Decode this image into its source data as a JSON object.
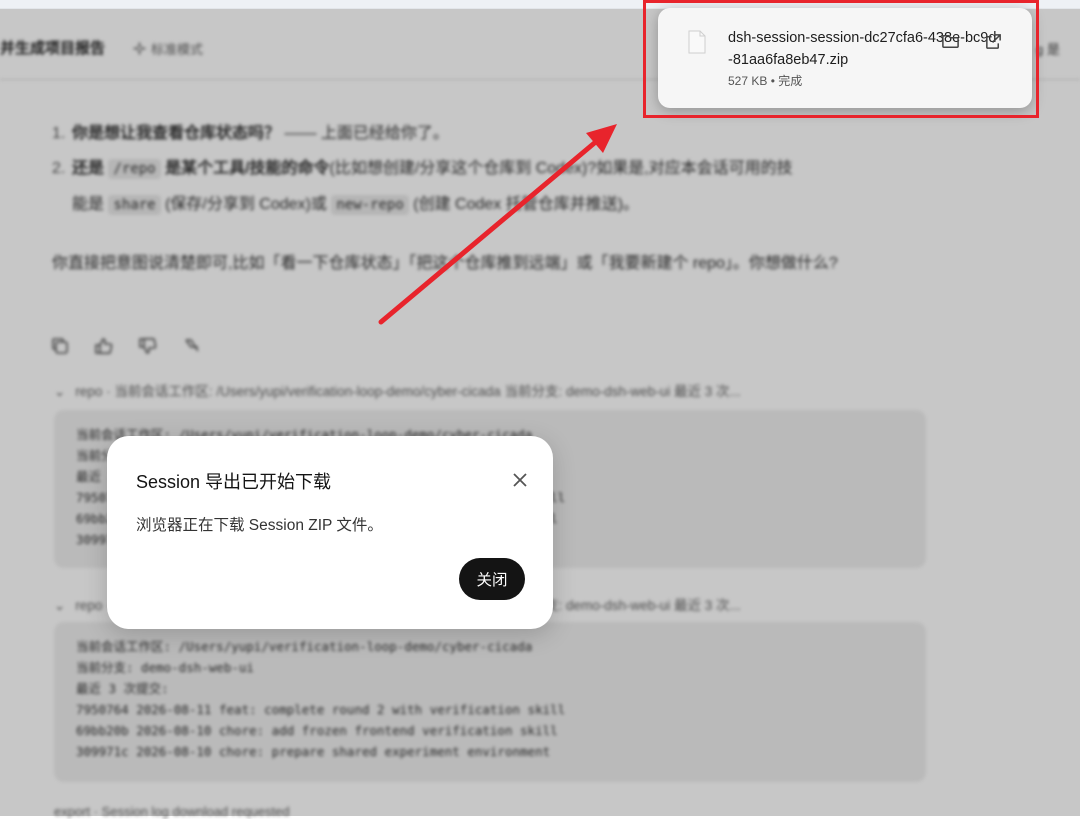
{
  "header": {
    "title": "并生成项目报告",
    "mode_label": "标准模式",
    "right_text": "g 是"
  },
  "messages": {
    "item1_num": "1.",
    "item1_bold": "你是想让我查看仓库状态吗？",
    "item1_rest": "—— 上面已经给你了。",
    "item2_num": "2.",
    "item2_bold_a": "还是",
    "item2_code": "/repo",
    "item2_bold_b": "是某个工具/技能的命令",
    "item2_rest": "(比如想创建/分享这个仓库到 Codex)?如果是,对应本会话可用的技",
    "item2_line2_a": "能是",
    "item2_code2": "share",
    "item2_line2_b": "(保存/分享到 Codex)或",
    "item2_code3": "new-repo",
    "item2_line2_c": "(创建 Codex 托管仓库并推送)。",
    "para": "你直接把意图说清楚即可,比如「看一下仓库状态」「把这个仓库推到远端」或「我要新建个 repo」。你想做什么?"
  },
  "tool1": {
    "summary": "repo · 当前会话工作区: /Users/yupi/verification-loop-demo/cyber-cicada 当前分支: demo-dsh-web-ui 最近 3 次...",
    "lines": [
      "当前会话工作区: /Users/yupi/verification-loop-demo/cyber-cicada",
      "当前分支: demo-dsh-web-ui",
      "最近 3 次提交:",
      "7950764 2026-08-11 feat: complete round 2 with verification skill",
      "69bb20b 2026-08-10 chore: add frozen frontend verification skill",
      "309971c 2026-08-10 chore: prepare shared experiment environment"
    ]
  },
  "tool2": {
    "summary": "repo · 当前会话工作区: /Users/yupi/verification-loop-demo/cyber-cicada 当前分支: demo-dsh-web-ui 最近 3 次...",
    "lines": [
      "当前会话工作区: /Users/yupi/verification-loop-demo/cyber-cicada",
      "当前分支: demo-dsh-web-ui",
      "最近 3 次提交:",
      "7950764 2026-08-11 feat: complete round 2 with verification skill",
      "69bb20b 2026-08-10 chore: add frozen frontend verification skill",
      "309971c 2026-08-10 chore: prepare shared experiment environment"
    ]
  },
  "footer": {
    "text": "export · Session log download requested"
  },
  "download": {
    "filename": "dsh-session-session-dc27cfa6-438e-bc9d-81aa6fa8eb47.zip",
    "size": "527 KB",
    "separator": "•",
    "status": "完成",
    "icons": [
      "file-icon",
      "folder-icon",
      "open-external-icon"
    ]
  },
  "dialog": {
    "title": "Session 导出已开始下载",
    "body": "浏览器正在下载 Session ZIP 文件。",
    "button": "关闭"
  },
  "colors": {
    "highlight": "#e8242c",
    "dialog_button": "#141414"
  }
}
